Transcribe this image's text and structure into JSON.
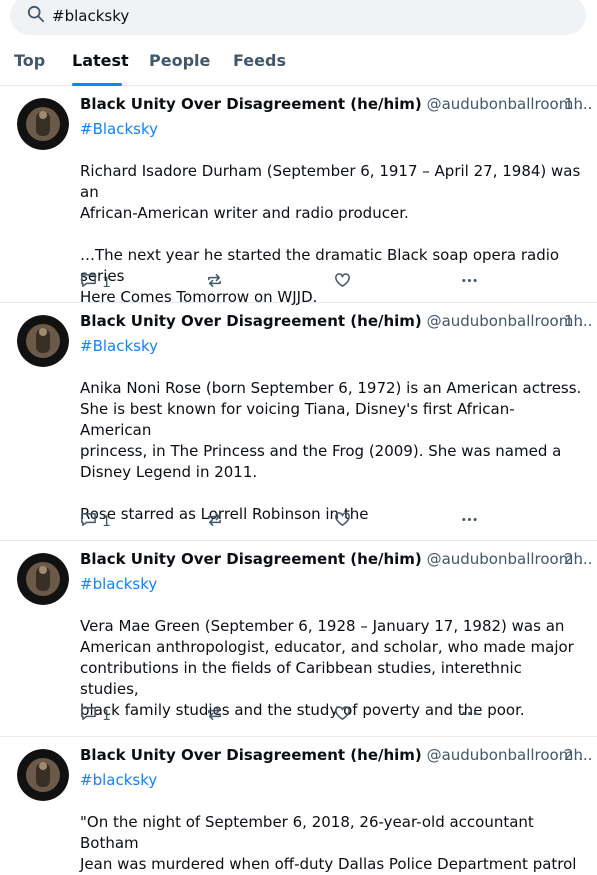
{
  "search": {
    "value": "#blacksky"
  },
  "tabs": [
    {
      "label": "Top"
    },
    {
      "label": "Latest"
    },
    {
      "label": "People"
    },
    {
      "label": "Feeds"
    }
  ],
  "colors": {
    "accent": "#1083fe",
    "muted": "#42576c",
    "divider": "#e6e9ed"
  },
  "posts": [
    {
      "author": "Black Unity Over Disagreement (he/him)",
      "handle": "@audubonballroom....",
      "time": "· 1h",
      "hashtag": "#Blacksky",
      "text": "Richard Isadore Durham (September 6, 1917 – April 27, 1984) was an\nAfrican-American writer and radio producer.\n\n…The next year he started the dramatic Black soap opera radio series\nHere Comes Tomorrow on WJJD.",
      "replies": "1"
    },
    {
      "author": "Black Unity Over Disagreement (he/him)",
      "handle": "@audubonballroom....",
      "time": "· 1h",
      "hashtag": "#Blacksky",
      "text": "Anika Noni Rose (born September 6, 1972) is an American actress.\nShe is best known for voicing Tiana, Disney's first African-American\nprincess, in The Princess and the Frog (2009). She was named a\nDisney Legend in 2011.\n\nRose starred as Lorrell Robinson in the",
      "replies": "1"
    },
    {
      "author": "Black Unity Over Disagreement (he/him)",
      "handle": "@audubonballroom....",
      "time": "· 2h",
      "hashtag": "#blacksky",
      "text": "Vera Mae Green (September 6, 1928 – January 17, 1982) was an\nAmerican anthropologist, educator, and scholar, who made major\ncontributions in the fields of Caribbean studies, interethnic studies,\nblack family studies and the study of poverty and the poor.",
      "replies": "1"
    },
    {
      "author": "Black Unity Over Disagreement (he/him)",
      "handle": "@audubonballroom....",
      "time": "· 2h",
      "hashtag": "#blacksky",
      "text": "\"On the night of September 6, 2018, 26-year-old accountant Botham\nJean was murdered when off-duty Dallas Police Department patrol",
      "replies": ""
    }
  ]
}
